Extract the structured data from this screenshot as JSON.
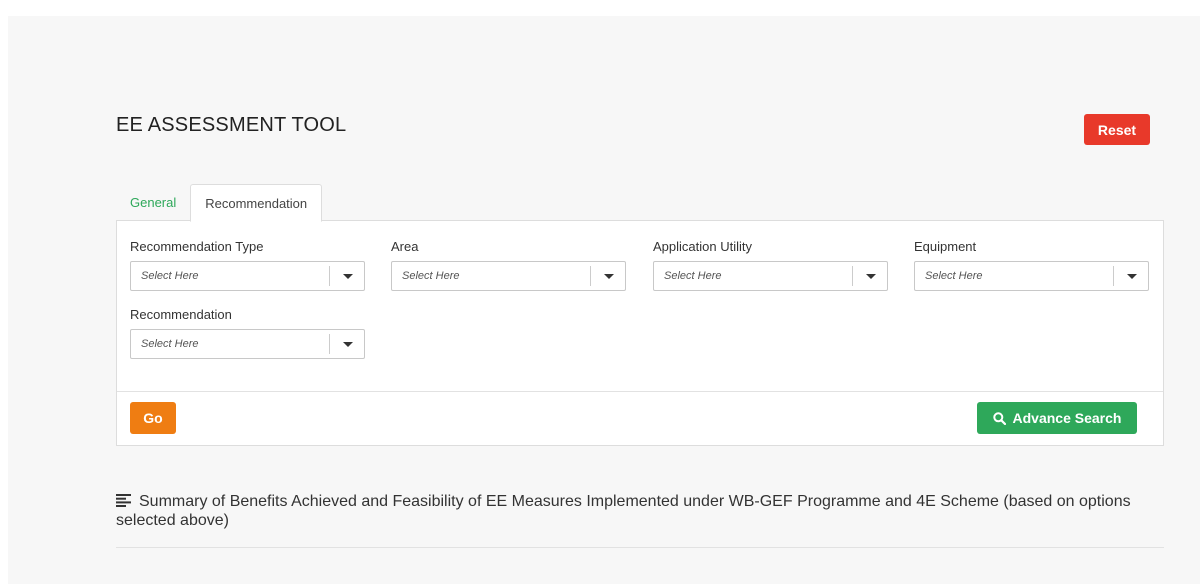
{
  "header": {
    "title": "EE ASSESSMENT TOOL",
    "reset_label": "Reset"
  },
  "tabs": [
    {
      "label": "General",
      "active": false
    },
    {
      "label": "Recommendation",
      "active": true
    }
  ],
  "filters": [
    {
      "label": "Recommendation Type",
      "placeholder": "Select Here"
    },
    {
      "label": "Area",
      "placeholder": "Select Here"
    },
    {
      "label": "Application Utility",
      "placeholder": "Select Here"
    },
    {
      "label": "Equipment",
      "placeholder": "Select Here"
    },
    {
      "label": "Recommendation",
      "placeholder": "Select Here"
    }
  ],
  "actions": {
    "go_label": "Go",
    "advance_search_label": "Advance Search"
  },
  "summary": {
    "text": "Summary of Benefits Achieved and Feasibility of EE Measures Implemented under WB-GEF Programme and 4E Scheme (based on options selected above)"
  },
  "colors": {
    "reset": "#e8392a",
    "go": "#ef7d12",
    "advance_search": "#2ea85a",
    "tab_link": "#2ea85a"
  },
  "icons": {
    "advance_search": "search-icon",
    "summary": "list-icon",
    "dropdown": "caret-down-icon"
  }
}
